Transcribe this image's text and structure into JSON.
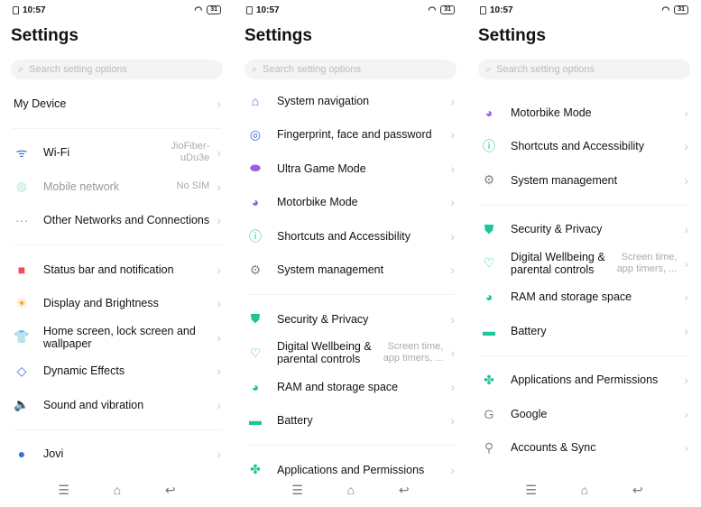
{
  "status": {
    "time": "10:57",
    "battery": "31"
  },
  "title": "Settings",
  "search_placeholder": "Search setting options",
  "panels": [
    {
      "groups": [
        [
          {
            "label": "My Device",
            "icon": "none"
          }
        ],
        [
          {
            "label": "Wi-Fi",
            "value": "JioFiber-uDu3e",
            "icon": "wifi-icon",
            "color": "#3a6fd8",
            "glyph": "ᯤ"
          },
          {
            "label": "Mobile network",
            "value": "No SIM",
            "icon": "globe-icon",
            "color": "#bfe5e0",
            "glyph": "◍",
            "dim": true
          },
          {
            "label": "Other Networks and Connections",
            "icon": "more-dots-icon",
            "color": "#999",
            "glyph": "···"
          }
        ],
        [
          {
            "label": "Status bar and notification",
            "icon": "status-bar-icon",
            "color": "#f04c5c",
            "glyph": "■"
          },
          {
            "label": "Display and Brightness",
            "icon": "sun-icon",
            "color": "#f5a623",
            "glyph": "☀"
          },
          {
            "label": "Home screen, lock screen and wallpaper",
            "icon": "shirt-icon",
            "color": "#f04c5c",
            "glyph": "👕"
          },
          {
            "label": "Dynamic Effects",
            "icon": "diamond-icon",
            "color": "#3a6fd8",
            "glyph": "◇"
          },
          {
            "label": "Sound and vibration",
            "icon": "speaker-icon",
            "color": "#f04c5c",
            "glyph": "🔈"
          }
        ],
        [
          {
            "label": "Jovi",
            "icon": "jovi-icon",
            "color": "#3a6fd8",
            "glyph": "●"
          }
        ]
      ]
    },
    {
      "groups": [
        [
          {
            "label": "System navigation",
            "icon": "navigation-icon",
            "color": "#3a6fd8",
            "glyph": "⌂"
          },
          {
            "label": "Fingerprint, face and password",
            "icon": "fingerprint-icon",
            "color": "#3a6fd8",
            "glyph": "◎"
          },
          {
            "label": "Ultra Game Mode",
            "icon": "gamepad-icon",
            "color": "#9b5de5",
            "glyph": "⬬"
          },
          {
            "label": "Motorbike Mode",
            "icon": "helmet-icon",
            "color": "#9b5de5",
            "glyph": "◕"
          },
          {
            "label": "Shortcuts and Accessibility",
            "icon": "accessibility-icon",
            "color": "#1cc59a",
            "glyph": "ⓘ"
          },
          {
            "label": "System management",
            "icon": "gear-icon",
            "color": "#888",
            "glyph": "⚙"
          }
        ],
        [
          {
            "label": "Security & Privacy",
            "icon": "shield-icon",
            "color": "#1cc59a",
            "glyph": "⛊"
          },
          {
            "label": "Digital Wellbeing & parental controls",
            "value": "Screen time, app timers, ...",
            "icon": "wellbeing-icon",
            "color": "#1cc59a",
            "glyph": "♡"
          },
          {
            "label": "RAM and storage space",
            "icon": "pie-chart-icon",
            "color": "#1cc59a",
            "glyph": "◕"
          },
          {
            "label": "Battery",
            "icon": "battery-icon",
            "color": "#1cc59a",
            "glyph": "▬"
          }
        ],
        [
          {
            "label": "Applications and Permissions",
            "icon": "apps-icon",
            "color": "#1cc59a",
            "glyph": "✤"
          }
        ]
      ]
    },
    {
      "groups": [
        [
          {
            "label": "Motorbike Mode",
            "icon": "helmet-icon",
            "color": "#9b5de5",
            "glyph": "◕"
          },
          {
            "label": "Shortcuts and Accessibility",
            "icon": "accessibility-icon",
            "color": "#1cc59a",
            "glyph": "ⓘ"
          },
          {
            "label": "System management",
            "icon": "gear-icon",
            "color": "#888",
            "glyph": "⚙"
          }
        ],
        [
          {
            "label": "Security & Privacy",
            "icon": "shield-icon",
            "color": "#1cc59a",
            "glyph": "⛊"
          },
          {
            "label": "Digital Wellbeing & parental controls",
            "value": "Screen time, app timers, ...",
            "icon": "wellbeing-icon",
            "color": "#1cc59a",
            "glyph": "♡"
          },
          {
            "label": "RAM and storage space",
            "icon": "pie-chart-icon",
            "color": "#1cc59a",
            "glyph": "◕"
          },
          {
            "label": "Battery",
            "icon": "battery-icon",
            "color": "#1cc59a",
            "glyph": "▬"
          }
        ],
        [
          {
            "label": "Applications and Permissions",
            "icon": "apps-icon",
            "color": "#1cc59a",
            "glyph": "✤"
          },
          {
            "label": "Google",
            "icon": "google-icon",
            "color": "#888",
            "glyph": "G"
          },
          {
            "label": "Accounts & Sync",
            "icon": "key-icon",
            "color": "#888",
            "glyph": "⚲"
          }
        ]
      ]
    }
  ],
  "nav": {
    "menu": "☰",
    "home": "⌂",
    "back": "↩"
  }
}
